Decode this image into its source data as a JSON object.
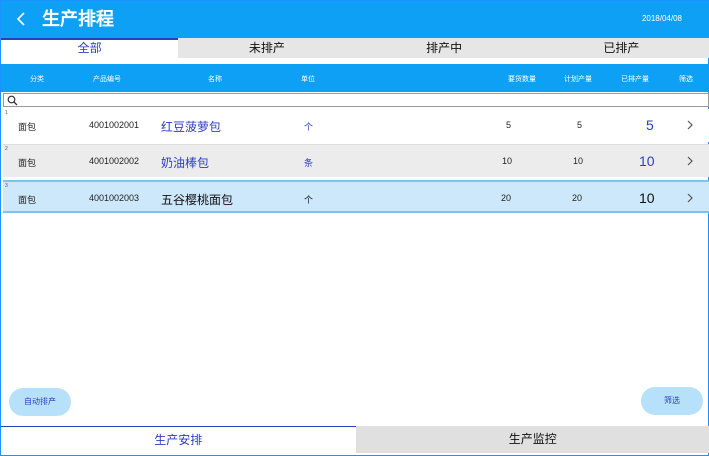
{
  "header": {
    "title": "生产排程",
    "date": "2018/04/08",
    "back_icon": "chevron-left-icon"
  },
  "tabs": [
    {
      "label": "全部",
      "active": true
    },
    {
      "label": "未排产",
      "active": false
    },
    {
      "label": "排产中",
      "active": false
    },
    {
      "label": "已排产",
      "active": false
    }
  ],
  "columns": {
    "category": "分类",
    "product_code": "产品编号",
    "name": "名称",
    "unit": "单位",
    "required_qty": "要货数量",
    "planned_qty": "计划产量",
    "scheduled_qty": "已排产量",
    "filter": "筛选"
  },
  "search": {
    "icon": "search-icon"
  },
  "rows": [
    {
      "index": "1",
      "category": "面包",
      "code": "4001002001",
      "name": "红豆菠萝包",
      "unit": "个",
      "required": "5",
      "planned": "5",
      "scheduled": "5"
    },
    {
      "index": "2",
      "category": "面包",
      "code": "4001002002",
      "name": "奶油棒包",
      "unit": "条",
      "required": "10",
      "planned": "10",
      "scheduled": "10"
    },
    {
      "index": "3",
      "category": "面包",
      "code": "4001002003",
      "name": "五谷樱桃面包",
      "unit": "个",
      "required": "20",
      "planned": "20",
      "scheduled": "10"
    }
  ],
  "buttons": {
    "auto_schedule": "自动排产",
    "filter": "筛选"
  },
  "bottom_nav": [
    {
      "label": "生产安排",
      "active": true
    },
    {
      "label": "生产监控",
      "active": false
    }
  ],
  "colors": {
    "accent": "#0ea0f5",
    "text_blue": "#2b3fbf",
    "selected_row": "#cde8fb"
  }
}
